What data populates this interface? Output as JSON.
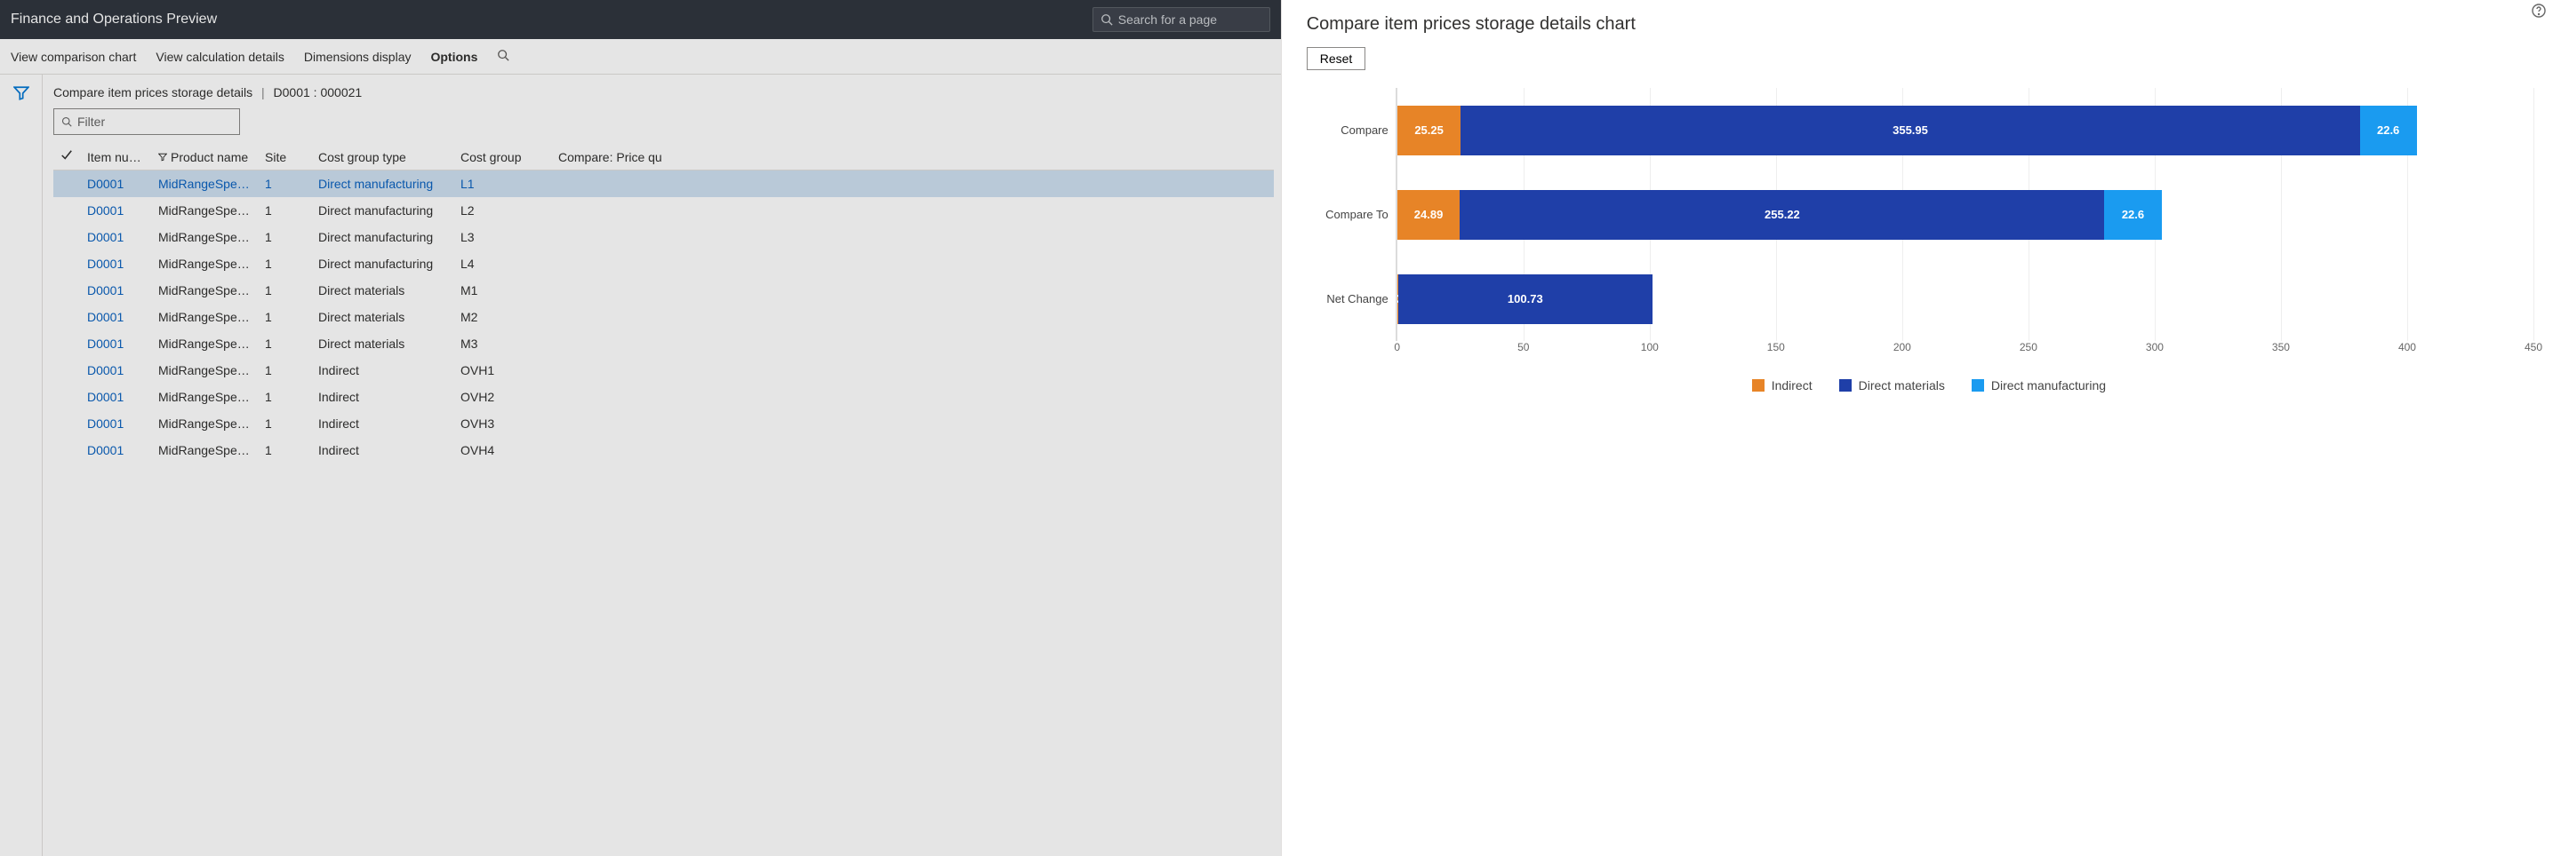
{
  "header": {
    "title": "Finance and Operations Preview",
    "search_placeholder": "Search for a page"
  },
  "cmd_bar": {
    "items": [
      "View comparison chart",
      "View calculation details",
      "Dimensions display",
      "Options"
    ],
    "active_index": 3
  },
  "crumb": {
    "page": "Compare item prices storage details",
    "context": "D0001 : 000021"
  },
  "filter_placeholder": "Filter",
  "columns": {
    "item": "Item nu…",
    "product": "Product name",
    "site": "Site",
    "ctype": "Cost group type",
    "cgrp": "Cost group",
    "cmp": "Compare: Price qu"
  },
  "rows": [
    {
      "item": "D0001",
      "product": "MidRangeSpeak…",
      "site": "1",
      "ctype": "Direct manufacturing",
      "cgrp": "L1"
    },
    {
      "item": "D0001",
      "product": "MidRangeSpeak…",
      "site": "1",
      "ctype": "Direct manufacturing",
      "cgrp": "L2"
    },
    {
      "item": "D0001",
      "product": "MidRangeSpeak…",
      "site": "1",
      "ctype": "Direct manufacturing",
      "cgrp": "L3"
    },
    {
      "item": "D0001",
      "product": "MidRangeSpeak…",
      "site": "1",
      "ctype": "Direct manufacturing",
      "cgrp": "L4"
    },
    {
      "item": "D0001",
      "product": "MidRangeSpeak…",
      "site": "1",
      "ctype": "Direct materials",
      "cgrp": "M1"
    },
    {
      "item": "D0001",
      "product": "MidRangeSpeak…",
      "site": "1",
      "ctype": "Direct materials",
      "cgrp": "M2"
    },
    {
      "item": "D0001",
      "product": "MidRangeSpeak…",
      "site": "1",
      "ctype": "Direct materials",
      "cgrp": "M3"
    },
    {
      "item": "D0001",
      "product": "MidRangeSpeak…",
      "site": "1",
      "ctype": "Indirect",
      "cgrp": "OVH1"
    },
    {
      "item": "D0001",
      "product": "MidRangeSpeak…",
      "site": "1",
      "ctype": "Indirect",
      "cgrp": "OVH2"
    },
    {
      "item": "D0001",
      "product": "MidRangeSpeak…",
      "site": "1",
      "ctype": "Indirect",
      "cgrp": "OVH3"
    },
    {
      "item": "D0001",
      "product": "MidRangeSpeak…",
      "site": "1",
      "ctype": "Indirect",
      "cgrp": "OVH4"
    }
  ],
  "selected_row": 0,
  "chart": {
    "title": "Compare item prices storage details chart",
    "reset_label": "Reset"
  },
  "legend": {
    "indirect": "Indirect",
    "materials": "Direct materials",
    "manufacturing": "Direct manufacturing"
  },
  "chart_data": {
    "type": "bar",
    "orientation": "horizontal",
    "stacked": true,
    "title": "Compare item prices storage details chart",
    "xlabel": "",
    "ylabel": "",
    "xlim": [
      0,
      450
    ],
    "x_ticks": [
      0,
      50,
      100,
      150,
      200,
      250,
      300,
      350,
      400,
      450
    ],
    "categories": [
      "Compare",
      "Compare To",
      "Net Change"
    ],
    "series": [
      {
        "name": "Indirect",
        "color": "#e78427",
        "values": [
          25.25,
          24.89,
          0.36
        ]
      },
      {
        "name": "Direct materials",
        "color": "#1f3fa8",
        "values": [
          355.95,
          255.22,
          100.73
        ]
      },
      {
        "name": "Direct manufacturing",
        "color": "#1a9bf0",
        "values": [
          22.6,
          22.6,
          0
        ]
      }
    ]
  }
}
